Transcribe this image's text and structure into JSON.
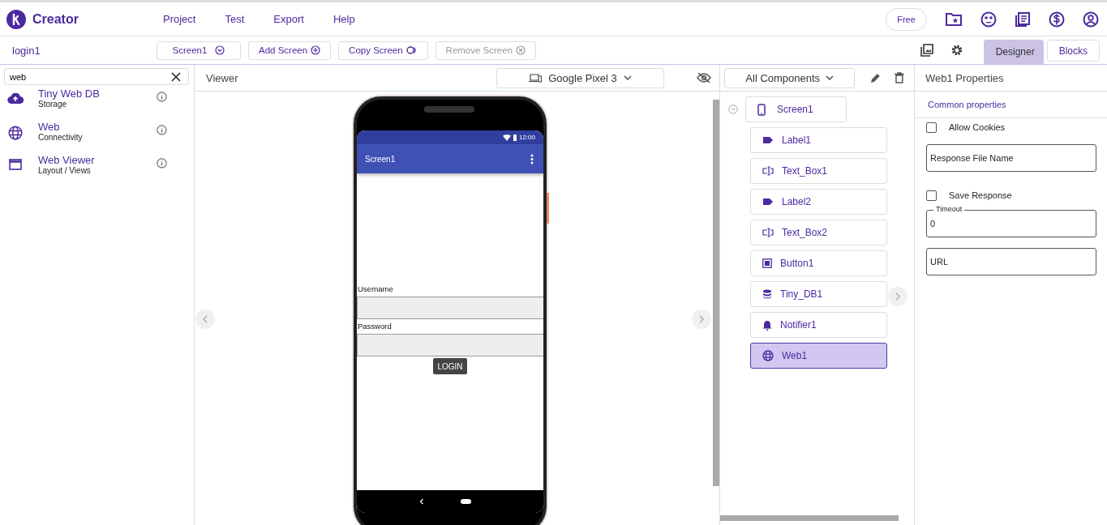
{
  "app": {
    "name": "Creator"
  },
  "menu": [
    "Project",
    "Test",
    "Export",
    "Help"
  ],
  "plan_badge": "Free",
  "project": "login1",
  "screen_buttons": [
    {
      "label": "Screen1",
      "kind": "dropdown",
      "disabled": false
    },
    {
      "label": "Add Screen",
      "kind": "add",
      "disabled": false
    },
    {
      "label": "Copy Screen",
      "kind": "copy",
      "disabled": false
    },
    {
      "label": "Remove Screen",
      "kind": "remove",
      "disabled": true
    }
  ],
  "view_tabs": [
    {
      "label": "Designer",
      "selected": true
    },
    {
      "label": "Blocks",
      "selected": false
    }
  ],
  "palette": {
    "search": {
      "value": "web"
    },
    "items": [
      {
        "name": "Tiny Web DB",
        "category": "Storage",
        "kind": "cloud"
      },
      {
        "name": "Web",
        "category": "Connectivity",
        "kind": "globe"
      },
      {
        "name": "Web Viewer",
        "category": "Layout / Views",
        "kind": "window"
      }
    ]
  },
  "viewer": {
    "title": "Viewer",
    "device": "Google Pixel 3",
    "phone": {
      "time": "12:00",
      "title": "Screen1",
      "fields": [
        {
          "label": "Username"
        },
        {
          "label": "Password"
        }
      ],
      "button": "LOGIN"
    }
  },
  "components": {
    "filter": "All Components",
    "tree": {
      "name": "Screen1",
      "kind": "screen",
      "expanded": true,
      "selected": false,
      "children": [
        {
          "name": "Label1",
          "kind": "label",
          "selected": false
        },
        {
          "name": "Text_Box1",
          "kind": "textbox",
          "selected": false
        },
        {
          "name": "Label2",
          "kind": "label",
          "selected": false
        },
        {
          "name": "Text_Box2",
          "kind": "textbox",
          "selected": false
        },
        {
          "name": "Button1",
          "kind": "button",
          "selected": false
        },
        {
          "name": "Tiny_DB1",
          "kind": "db",
          "selected": false
        },
        {
          "name": "Notifier1",
          "kind": "notifier",
          "selected": false
        },
        {
          "name": "Web1",
          "kind": "web",
          "selected": true
        }
      ]
    }
  },
  "properties": {
    "title": "Web1 Properties",
    "section": "Common properties",
    "items": [
      {
        "kind": "checkbox",
        "label": "Allow Cookies",
        "checked": false
      },
      {
        "kind": "field",
        "label": "Response File Name"
      },
      {
        "kind": "checkbox",
        "label": "Save Response",
        "checked": false
      },
      {
        "kind": "outlined",
        "label": "Timeout",
        "value": "0"
      },
      {
        "kind": "field",
        "label": "URL"
      }
    ]
  }
}
